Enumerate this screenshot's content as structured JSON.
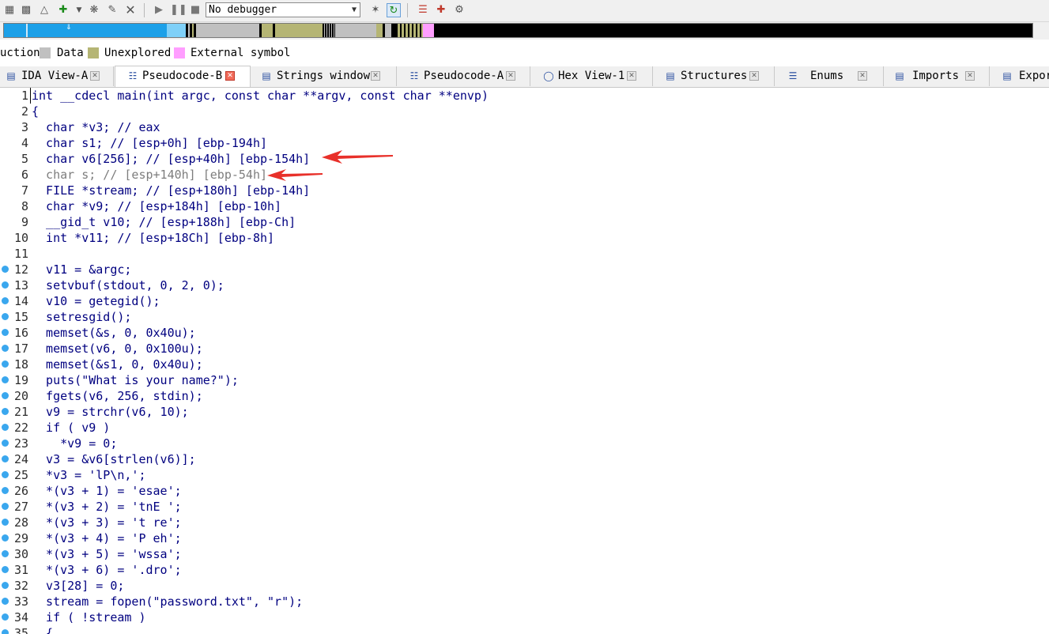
{
  "toolbar": {
    "debugger_select": "No debugger"
  },
  "legend": {
    "items": [
      {
        "label": "uction",
        "color": ""
      },
      {
        "label": "Data",
        "color": "#c0c0c0"
      },
      {
        "label": "Unexplored",
        "color": "#b5b574"
      },
      {
        "label": "External symbol",
        "color": "#ff9eff"
      }
    ]
  },
  "tabs": [
    {
      "label": "IDA View-A",
      "active": false
    },
    {
      "label": "Pseudocode-B",
      "active": true
    },
    {
      "label": "Strings window",
      "active": false
    },
    {
      "label": "Pseudocode-A",
      "active": false
    },
    {
      "label": "Hex View-1",
      "active": false
    },
    {
      "label": "Structures",
      "active": false
    },
    {
      "label": "Enums",
      "active": false
    },
    {
      "label": "Imports",
      "active": false
    },
    {
      "label": "Expor",
      "active": false
    }
  ],
  "code": {
    "lines": [
      {
        "n": "1",
        "bp": false,
        "text": "int __cdecl main(int argc, const char **argv, const char **envp)"
      },
      {
        "n": "2",
        "bp": false,
        "text": "{"
      },
      {
        "n": "3",
        "bp": false,
        "text": "  char *v3; // eax"
      },
      {
        "n": "4",
        "bp": false,
        "text": "  char s1; // [esp+0h] [ebp-194h]"
      },
      {
        "n": "5",
        "bp": false,
        "text": "  char v6[256]; // [esp+40h] [ebp-154h]"
      },
      {
        "n": "6",
        "bp": false,
        "text": "  char s; // [esp+140h] [ebp-54h]"
      },
      {
        "n": "7",
        "bp": false,
        "text": "  FILE *stream; // [esp+180h] [ebp-14h]"
      },
      {
        "n": "8",
        "bp": false,
        "text": "  char *v9; // [esp+184h] [ebp-10h]"
      },
      {
        "n": "9",
        "bp": false,
        "text": "  __gid_t v10; // [esp+188h] [ebp-Ch]"
      },
      {
        "n": "10",
        "bp": false,
        "text": "  int *v11; // [esp+18Ch] [ebp-8h]"
      },
      {
        "n": "11",
        "bp": false,
        "text": ""
      },
      {
        "n": "12",
        "bp": true,
        "text": "  v11 = &argc;"
      },
      {
        "n": "13",
        "bp": true,
        "text": "  setvbuf(stdout, 0, 2, 0);"
      },
      {
        "n": "14",
        "bp": true,
        "text": "  v10 = getegid();"
      },
      {
        "n": "15",
        "bp": true,
        "text": "  setresgid();"
      },
      {
        "n": "16",
        "bp": true,
        "text": "  memset(&s, 0, 0x40u);"
      },
      {
        "n": "17",
        "bp": true,
        "text": "  memset(v6, 0, 0x100u);"
      },
      {
        "n": "18",
        "bp": true,
        "text": "  memset(&s1, 0, 0x40u);"
      },
      {
        "n": "19",
        "bp": true,
        "text": "  puts(\"What is your name?\");"
      },
      {
        "n": "20",
        "bp": true,
        "text": "  fgets(v6, 256, stdin);"
      },
      {
        "n": "21",
        "bp": true,
        "text": "  v9 = strchr(v6, 10);"
      },
      {
        "n": "22",
        "bp": true,
        "text": "  if ( v9 )"
      },
      {
        "n": "23",
        "bp": true,
        "text": "    *v9 = 0;"
      },
      {
        "n": "24",
        "bp": true,
        "text": "  v3 = &v6[strlen(v6)];"
      },
      {
        "n": "25",
        "bp": true,
        "text": "  *v3 = 'lP\\n,';"
      },
      {
        "n": "26",
        "bp": true,
        "text": "  *(v3 + 1) = 'esae';"
      },
      {
        "n": "27",
        "bp": true,
        "text": "  *(v3 + 2) = 'tnE ';"
      },
      {
        "n": "28",
        "bp": true,
        "text": "  *(v3 + 3) = 't re';"
      },
      {
        "n": "29",
        "bp": true,
        "text": "  *(v3 + 4) = 'P eh';"
      },
      {
        "n": "30",
        "bp": true,
        "text": "  *(v3 + 5) = 'wssa';"
      },
      {
        "n": "31",
        "bp": true,
        "text": "  *(v3 + 6) = '.dro';"
      },
      {
        "n": "32",
        "bp": true,
        "text": "  v3[28] = 0;"
      },
      {
        "n": "33",
        "bp": true,
        "text": "  stream = fopen(\"password.txt\", \"r\");"
      },
      {
        "n": "34",
        "bp": true,
        "text": "  if ( !stream )"
      },
      {
        "n": "35",
        "bp": true,
        "text": "  {"
      }
    ]
  }
}
